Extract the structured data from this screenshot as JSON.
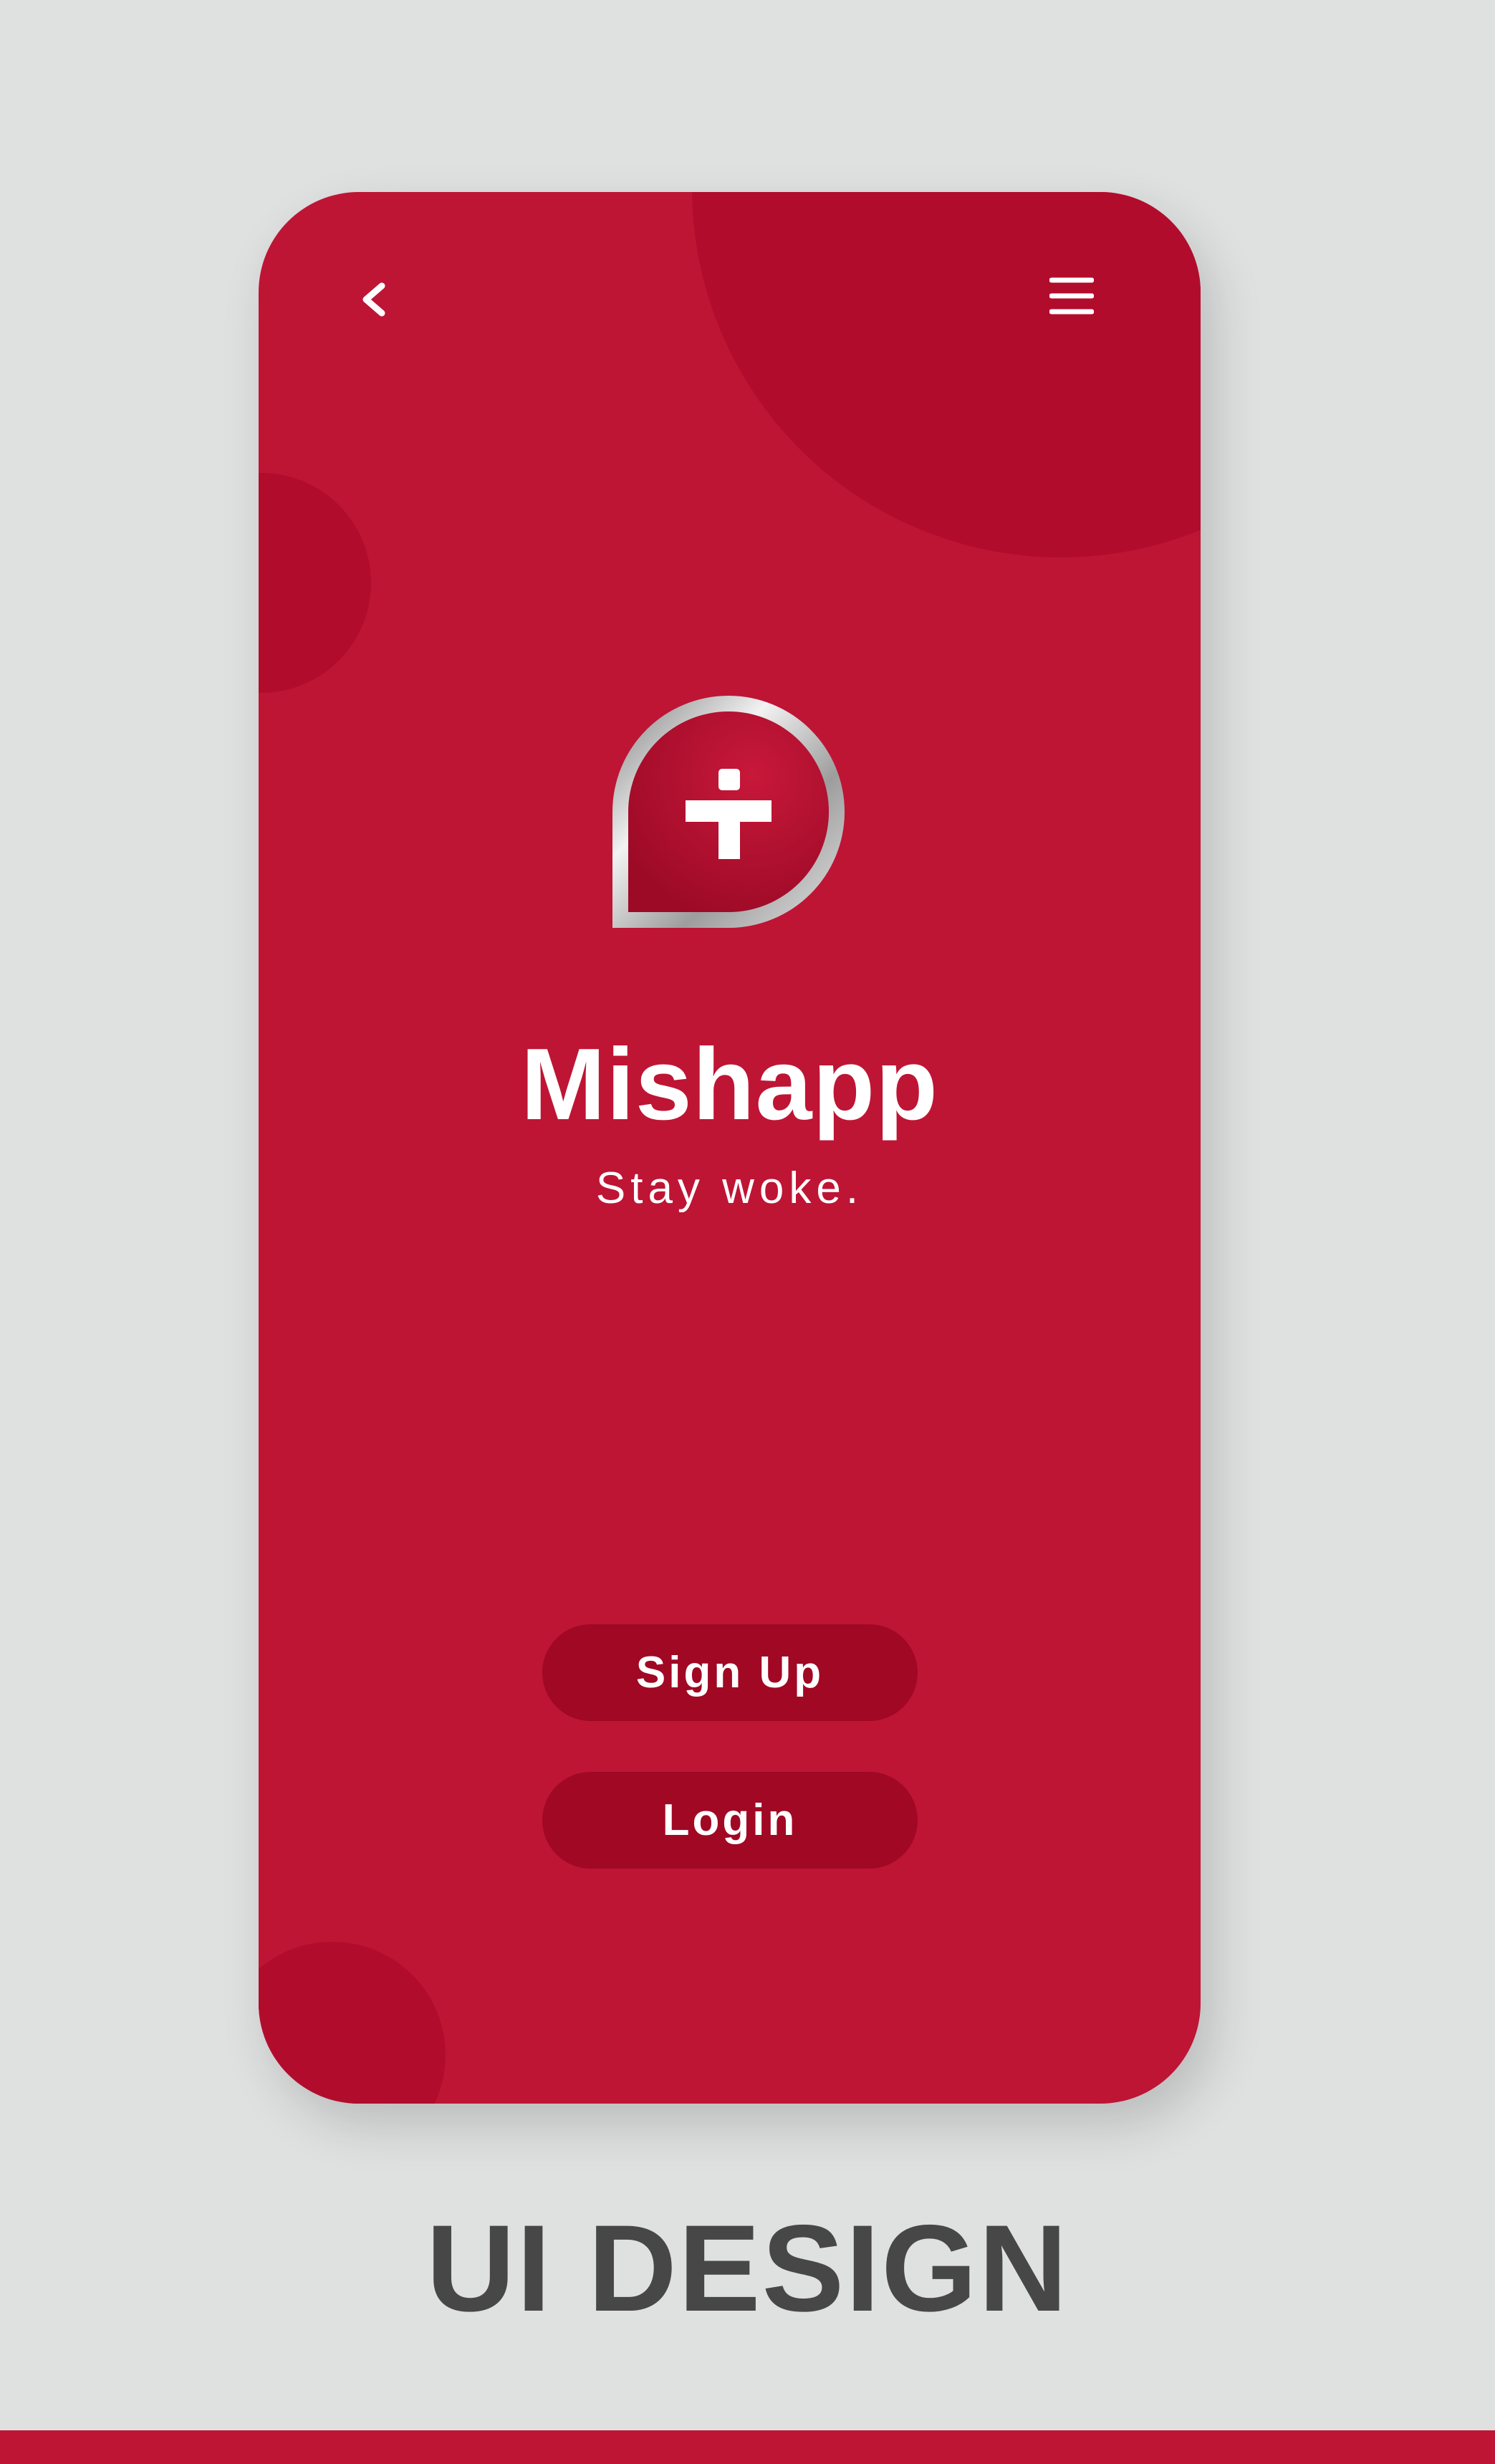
{
  "colors": {
    "background": "#dfe0e0",
    "accent": "#be1535",
    "accent_dark": "#b20c2d",
    "button": "#a00824",
    "text_light": "#ffffff",
    "caption_text": "#474747"
  },
  "header": {
    "back_icon": "chevron-left-icon",
    "menu_icon": "hamburger-menu-icon"
  },
  "app": {
    "logo_icon": "pin-plus-logo-icon",
    "name": "Mishapp",
    "tagline": "Stay woke."
  },
  "actions": {
    "signup_label": "Sign Up",
    "login_label": "Login"
  },
  "caption": "UI DESIGN"
}
